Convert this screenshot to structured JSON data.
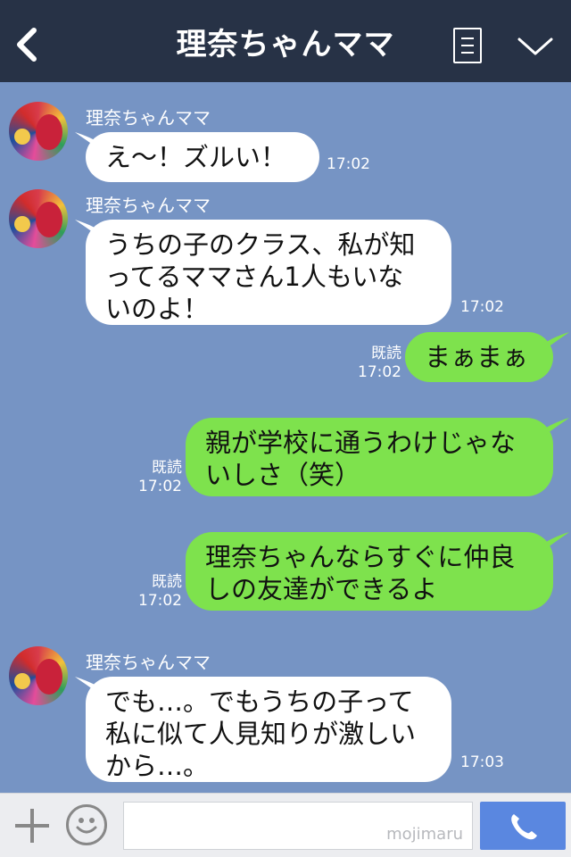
{
  "header": {
    "title": "理奈ちゃんママ"
  },
  "messages": [
    {
      "side": "left",
      "sender": "理奈ちゃんママ",
      "lines": [
        "え〜！ズルい！"
      ],
      "time": "17:02"
    },
    {
      "side": "left",
      "sender": "理奈ちゃんママ",
      "lines": [
        "うちの子のクラス、私が知",
        "ってるママさん1人もいな",
        "いのよ！"
      ],
      "time": "17:02"
    },
    {
      "side": "right",
      "read": "既読",
      "lines": [
        "まぁまぁ"
      ],
      "time": "17:02"
    },
    {
      "side": "right",
      "read": "既読",
      "lines": [
        "親が学校に通うわけじゃな",
        "いしさ（笑）"
      ],
      "time": "17:02"
    },
    {
      "side": "right",
      "read": "既読",
      "lines": [
        "理奈ちゃんならすぐに仲良",
        "しの友達ができるよ"
      ],
      "time": "17:02"
    },
    {
      "side": "left",
      "sender": "理奈ちゃんママ",
      "lines": [
        "でも…。でもうちの子って",
        "私に似て人見知りが激しい",
        "から…。"
      ],
      "time": "17:03"
    }
  ],
  "input": {
    "watermark": "mojimaru"
  },
  "colors": {
    "header_bg": "#273246",
    "chat_bg": "#7694c4",
    "my_bubble": "#7ee24d",
    "their_bubble": "#ffffff",
    "send_button": "#5a87e0"
  },
  "icons": {
    "back": "chevron-left-icon",
    "menu": "menu-icon",
    "collapse": "chevron-down-icon",
    "add": "plus-icon",
    "emoji": "smiley-icon",
    "send": "phone-icon"
  }
}
